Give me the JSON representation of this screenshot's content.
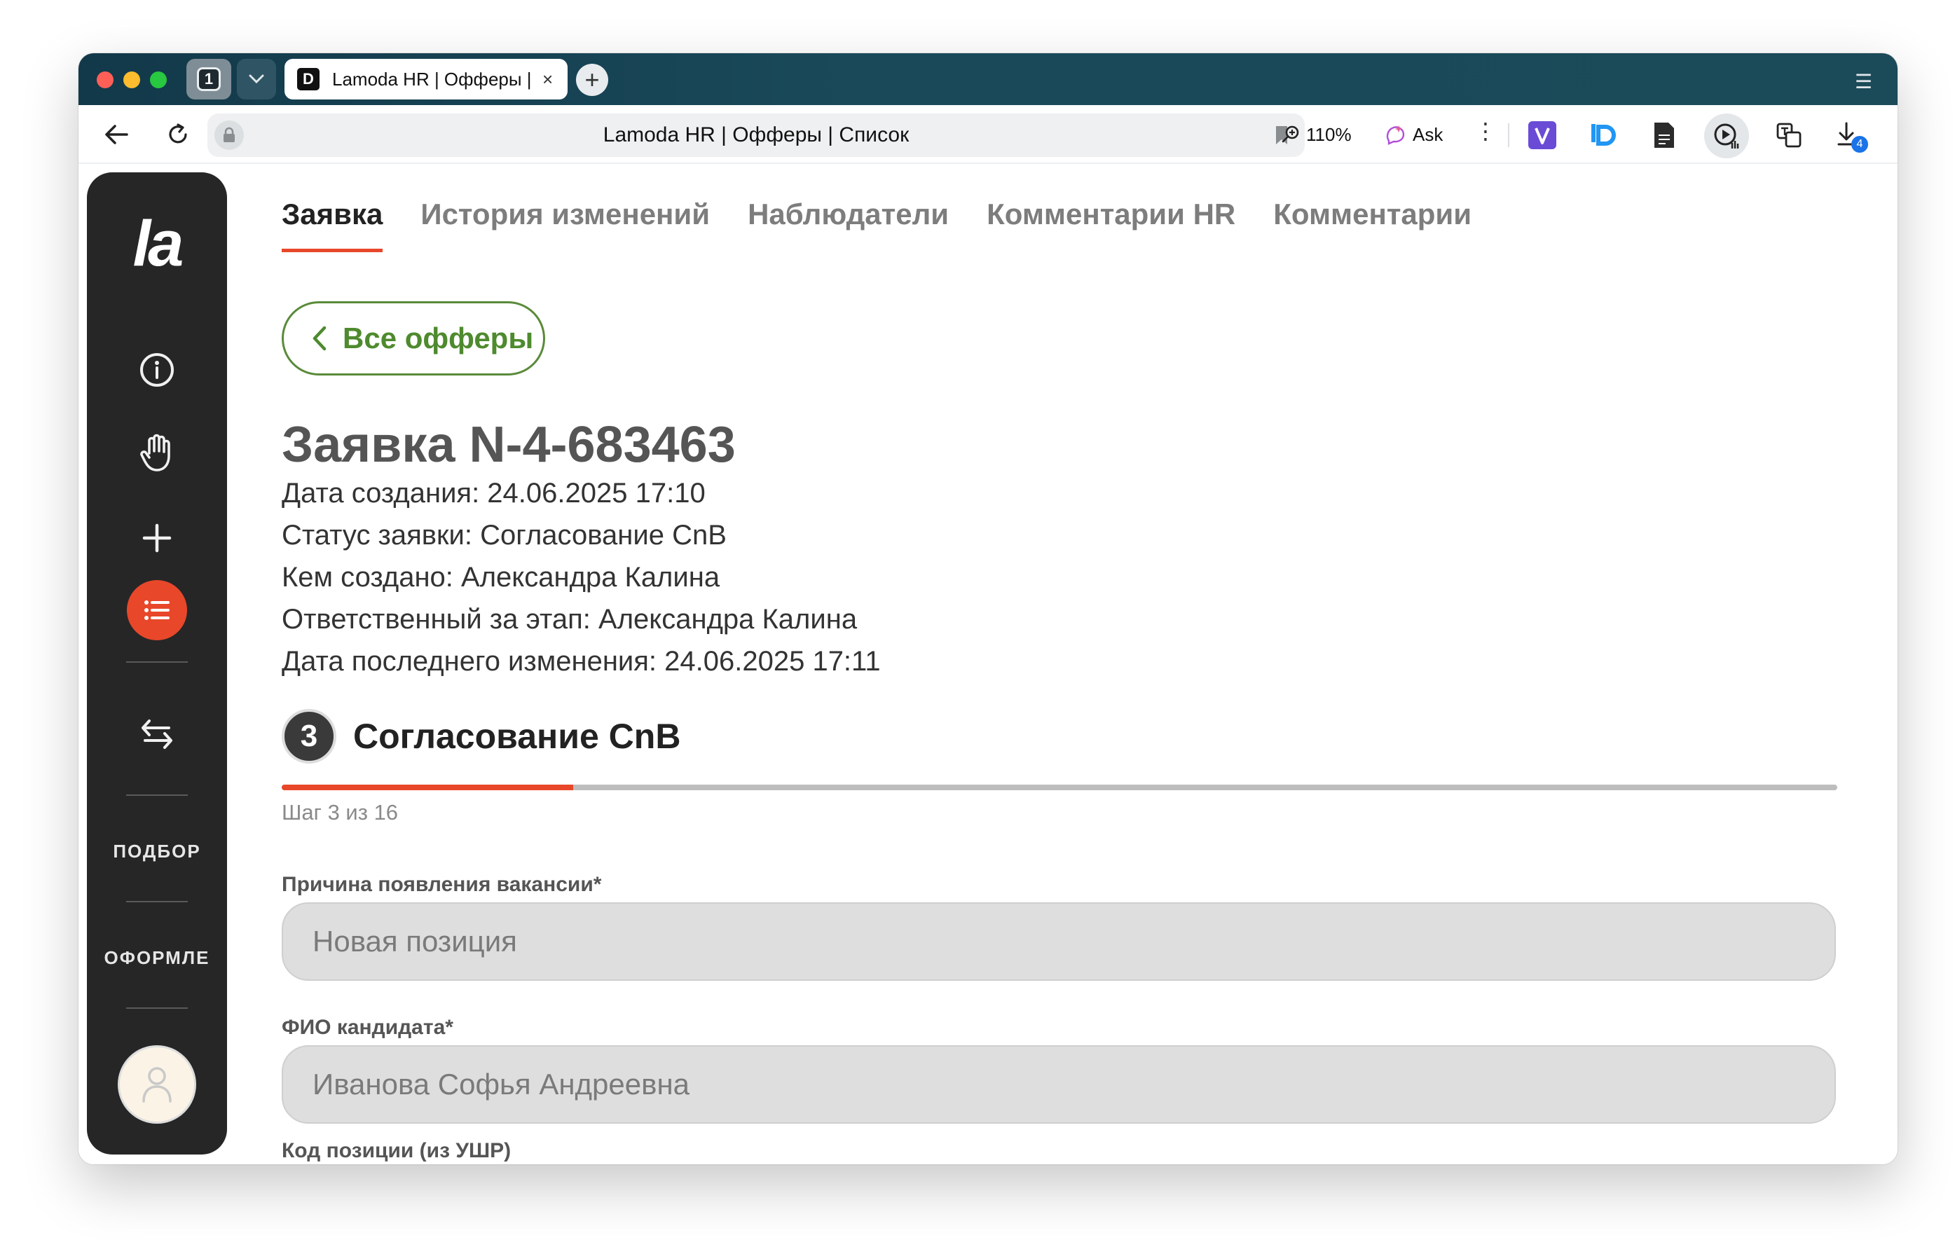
{
  "browser": {
    "tab_count": "1",
    "tab_title": "Lamoda HR | Офферы | Список",
    "tab_close": "×",
    "new_tab": "+",
    "url": "Lamoda HR | Офферы | Список",
    "zoom": "110%",
    "ask": "Ask",
    "downloads_badge": "4",
    "favicon_letter": "D",
    "kebab": "⋮",
    "menu": "☰"
  },
  "sidebar": {
    "logo": "la",
    "sections": [
      "ПОДБОР",
      "ОФОРМЛЕ"
    ]
  },
  "tabs": [
    {
      "label": "Заявка",
      "active": true
    },
    {
      "label": "История изменений",
      "active": false
    },
    {
      "label": "Наблюдатели",
      "active": false
    },
    {
      "label": "Комментарии HR",
      "active": false
    },
    {
      "label": "Комментарии",
      "active": false
    }
  ],
  "back_button": "Все офферы",
  "request": {
    "title": "Заявка N-4-683463",
    "meta": [
      "Дата создания: 24.06.2025 17:10",
      "Статус заявки: Согласование CnB",
      "Кем создано: Александра Калина",
      "Ответственный за этап: Александра Калина",
      "Дата последнего изменения: 24.06.2025 17:11"
    ]
  },
  "stage": {
    "number": "3",
    "title": "Согласование CnB",
    "step_text": "Шаг 3 из 16",
    "progress_fraction": 0.1875
  },
  "form": {
    "fields": [
      {
        "label": "Причина появления вакансии*",
        "value": "Новая позиция"
      },
      {
        "label": "ФИО кандидата*",
        "value": "Иванова Софья Андреевна"
      },
      {
        "label": "Код позиции (из УШР)",
        "value": ""
      }
    ]
  },
  "colors": {
    "accent": "#e8472a",
    "back_button": "#4e8a2e",
    "sidebar_bg": "#262626"
  }
}
